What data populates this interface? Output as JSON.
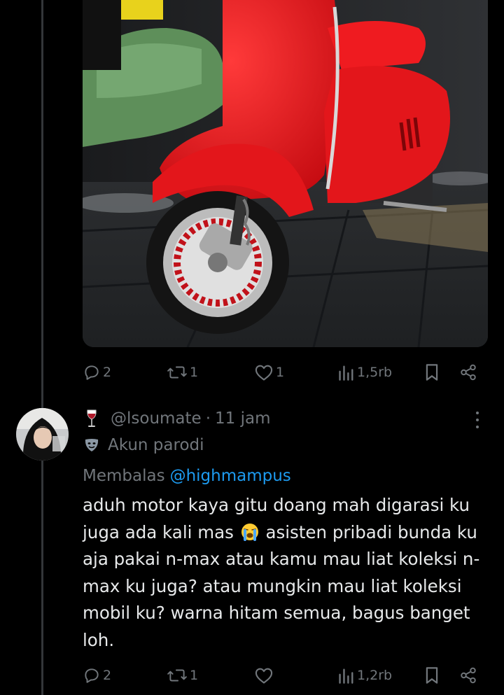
{
  "top_post": {
    "media": {
      "alt": "red-vespa-scooter-photo"
    },
    "actions": {
      "replies": "2",
      "reposts": "1",
      "likes": "1",
      "views": "1,5rb"
    }
  },
  "reply_post": {
    "author": {
      "handle": "@lsoumate",
      "emoji_icon": "wine-glass-icon"
    },
    "separator": "·",
    "time": "11 jam",
    "parody_label": "Akun parodi",
    "replying_to_label": "Membalas",
    "replying_to_handle": "@highmampus",
    "text": "aduh motor kaya gitu doang mah digarasi ku juga ada kali mas 😭 asisten pribadi bunda ku aja pakai n-max atau kamu mau liat koleksi n-max ku juga? atau mungkin mau liat koleksi mobil ku? warna hitam semua, bagus banget loh.",
    "text_part1": "aduh motor kaya gitu doang mah digarasi ku juga ada kali mas",
    "text_part2": "asisten pribadi bunda ku aja pakai n-max atau kamu mau liat koleksi n-max ku juga? atau mungkin mau liat koleksi mobil ku? warna hitam semua, bagus banget loh.",
    "actions": {
      "replies": "2",
      "reposts": "1",
      "likes": "",
      "views": "1,2rb"
    }
  },
  "colors": {
    "background": "#000000",
    "text": "#e7e9ea",
    "muted": "#71767b",
    "link": "#1d9bf0",
    "thread_line": "#333639",
    "scooter_red": "#e3161b"
  }
}
